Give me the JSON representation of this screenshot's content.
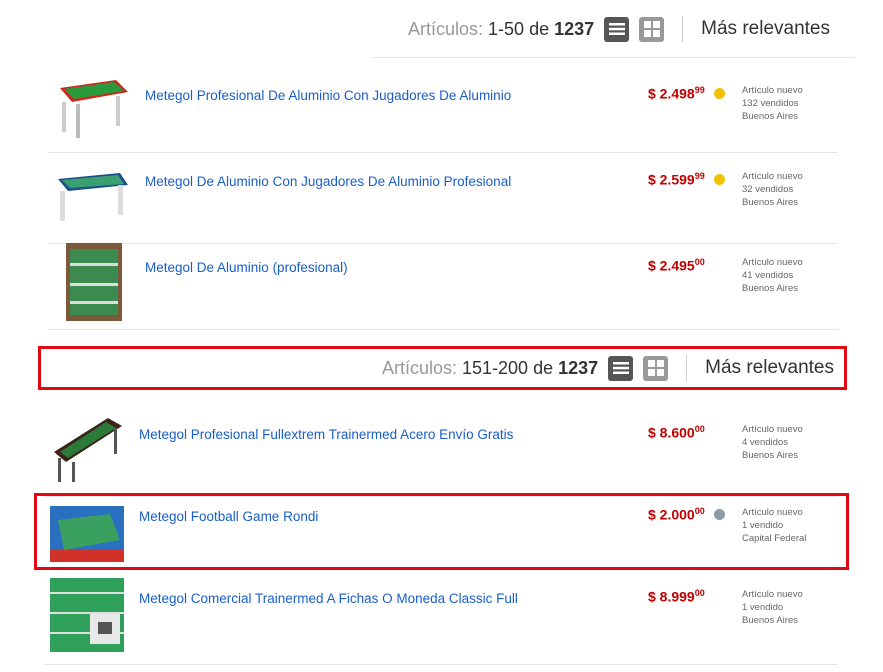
{
  "toolbar_top": {
    "label": "Artículos:",
    "range": "1-50",
    "of": "de",
    "total": "1237",
    "sort": "Más relevantes"
  },
  "toolbar_mid": {
    "label": "Artículos:",
    "range": "151-200",
    "of": "de",
    "total": "1237",
    "sort": "Más relevantes"
  },
  "items_top": [
    {
      "title": "Metegol Profesional De Aluminio Con Jugadores De Aluminio",
      "price": "$ 2.498",
      "cents": "99",
      "condition": "Artículo nuevo",
      "sold": "132 vendidos",
      "location": "Buenos Aires",
      "medal": "gold"
    },
    {
      "title": "Metegol De Aluminio Con Jugadores De Aluminio Profesional",
      "price": "$ 2.599",
      "cents": "99",
      "condition": "Artículo nuevo",
      "sold": "32 vendidos",
      "location": "Buenos Aires",
      "medal": "gold"
    },
    {
      "title": "Metegol De Aluminio (profesional)",
      "price": "$ 2.495",
      "cents": "00",
      "condition": "Artículo nuevo",
      "sold": "41 vendidos",
      "location": "Buenos Aires",
      "medal": ""
    }
  ],
  "items_bottom": [
    {
      "title": "Metegol Profesional Fullextrem Trainermed Acero Envío Gratis",
      "price": "$ 8.600",
      "cents": "00",
      "condition": "Artículo nuevo",
      "sold": "4 vendidos",
      "location": "Buenos Aires",
      "medal": ""
    },
    {
      "title": "Metegol Football Game Rondi",
      "price": "$ 2.000",
      "cents": "00",
      "condition": "Artículo nuevo",
      "sold": "1 vendido",
      "location": "Capital Federal",
      "medal": "silver"
    },
    {
      "title": "Metegol Comercial Trainermed A Fichas O Moneda Classic Full",
      "price": "$ 8.999",
      "cents": "00",
      "condition": "Artículo nuevo",
      "sold": "1 vendido",
      "location": "Buenos Aires",
      "medal": ""
    }
  ],
  "colors": {
    "title_link": "#1a5ec9",
    "price": "#c00000",
    "highlight": "#e30613",
    "gold_medal": "#f2c200",
    "silver_medal": "#8a9aa6"
  }
}
